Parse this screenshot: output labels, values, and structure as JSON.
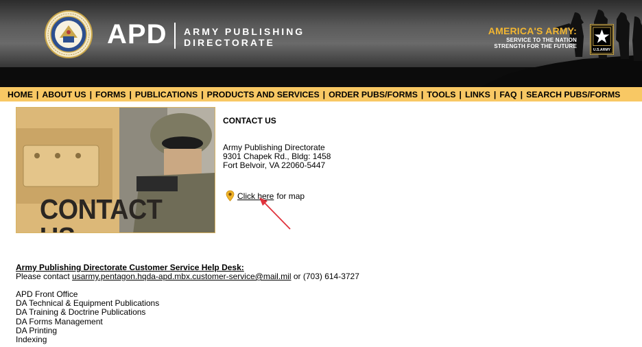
{
  "header": {
    "logo_acronym": "APD",
    "logo_line1": "ARMY PUBLISHING",
    "logo_line2": "DIRECTORATE",
    "seal_text": "ADMINISTRATIVE ASSISTANT TO THE SECRETARY OF THE ARMY",
    "slogan_title": "AMERICA'S ARMY:",
    "slogan_line1": "SERVICE TO THE NATION",
    "slogan_line2": "STRENGTH FOR THE FUTURE",
    "army_logo_text": "U.S.ARMY"
  },
  "nav": {
    "items": [
      "HOME",
      "ABOUT US",
      "FORMS",
      "PUBLICATIONS",
      "PRODUCTS AND SERVICES",
      "ORDER PUBS/FORMS",
      "TOOLS",
      "LINKS",
      "FAQ",
      "SEARCH PUBS/FORMS"
    ],
    "separator": "|"
  },
  "hero": {
    "text": "CONTACT US"
  },
  "contact": {
    "heading": "CONTACT US",
    "address_line1": "Army Publishing Directorate",
    "address_line2": "9301 Chapek Rd., Bldg: 1458",
    "address_line3": "Fort Belvoir, VA 22060-5447",
    "map_link": "Click here",
    "map_suffix": "for map"
  },
  "help_desk": {
    "heading": "Army Publishing Directorate Customer Service Help Desk:",
    "prefix": "Please contact",
    "email": "usarmy.pentagon.hqda-apd.mbx.customer-service@mail.mil",
    "middle": "or",
    "phone": "(703) 614-3727"
  },
  "offices": [
    "APD Front Office",
    "DA Technical & Equipment Publications",
    "DA Training & Doctrine Publications",
    "DA Forms Management",
    "DA Printing",
    "Indexing"
  ],
  "colors": {
    "nav_background": "#f8c864",
    "accent_gold": "#f2b632",
    "annotation_red": "#e0323c"
  }
}
